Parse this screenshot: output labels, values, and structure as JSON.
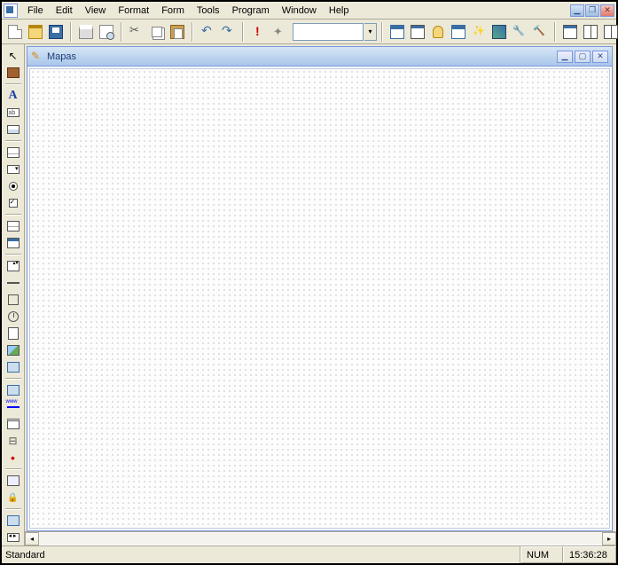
{
  "menu": {
    "items": [
      "File",
      "Edit",
      "View",
      "Format",
      "Form",
      "Tools",
      "Program",
      "Window",
      "Help"
    ]
  },
  "toolbar": {
    "new": "New",
    "open": "Open",
    "save": "Save",
    "print": "Print",
    "preview": "Print Preview",
    "cut": "Cut",
    "copy": "Copy",
    "paste": "Paste",
    "undo": "Undo",
    "redo": "Redo",
    "run": "Run",
    "modify": "Modify",
    "object_combo_value": "",
    "form": "Form",
    "autoform": "AutoFormat",
    "code": "Code Window",
    "props": "Properties",
    "dataenv": "Data Environment",
    "builder": "Builder",
    "options": "Tools",
    "buildall": "Build",
    "wintile": "Tile",
    "winh": "Horizontal",
    "winv": "Vertical",
    "cascade": "Cascade"
  },
  "sidebar": {
    "pointer": "Select Objects",
    "book": "View Classes",
    "label": "Label",
    "textbox": "Text Box",
    "editbox": "Edit Box",
    "listbox": "List Box",
    "combobox": "Combo Box",
    "option": "Option Group",
    "check": "Check Box",
    "grid": "Grid",
    "grid2": "CommandGroup",
    "spinner": "Spinner",
    "line": "Line",
    "shape": "Shape",
    "timer": "Timer",
    "pageframe": "Page Frame",
    "image": "Image",
    "ole": "OLE Control",
    "olebound": "OLE Bound",
    "hyperlink": "Hyperlink",
    "container": "Container",
    "separator": "Separator",
    "splitter": "ActiveX",
    "lock": "Builder Lock",
    "builder2": "Button",
    "datanav": "DataEnvironment"
  },
  "child_form": {
    "title": "Mapas"
  },
  "status": {
    "left": "Standard",
    "num": "NUM",
    "time": "15:36:28"
  }
}
